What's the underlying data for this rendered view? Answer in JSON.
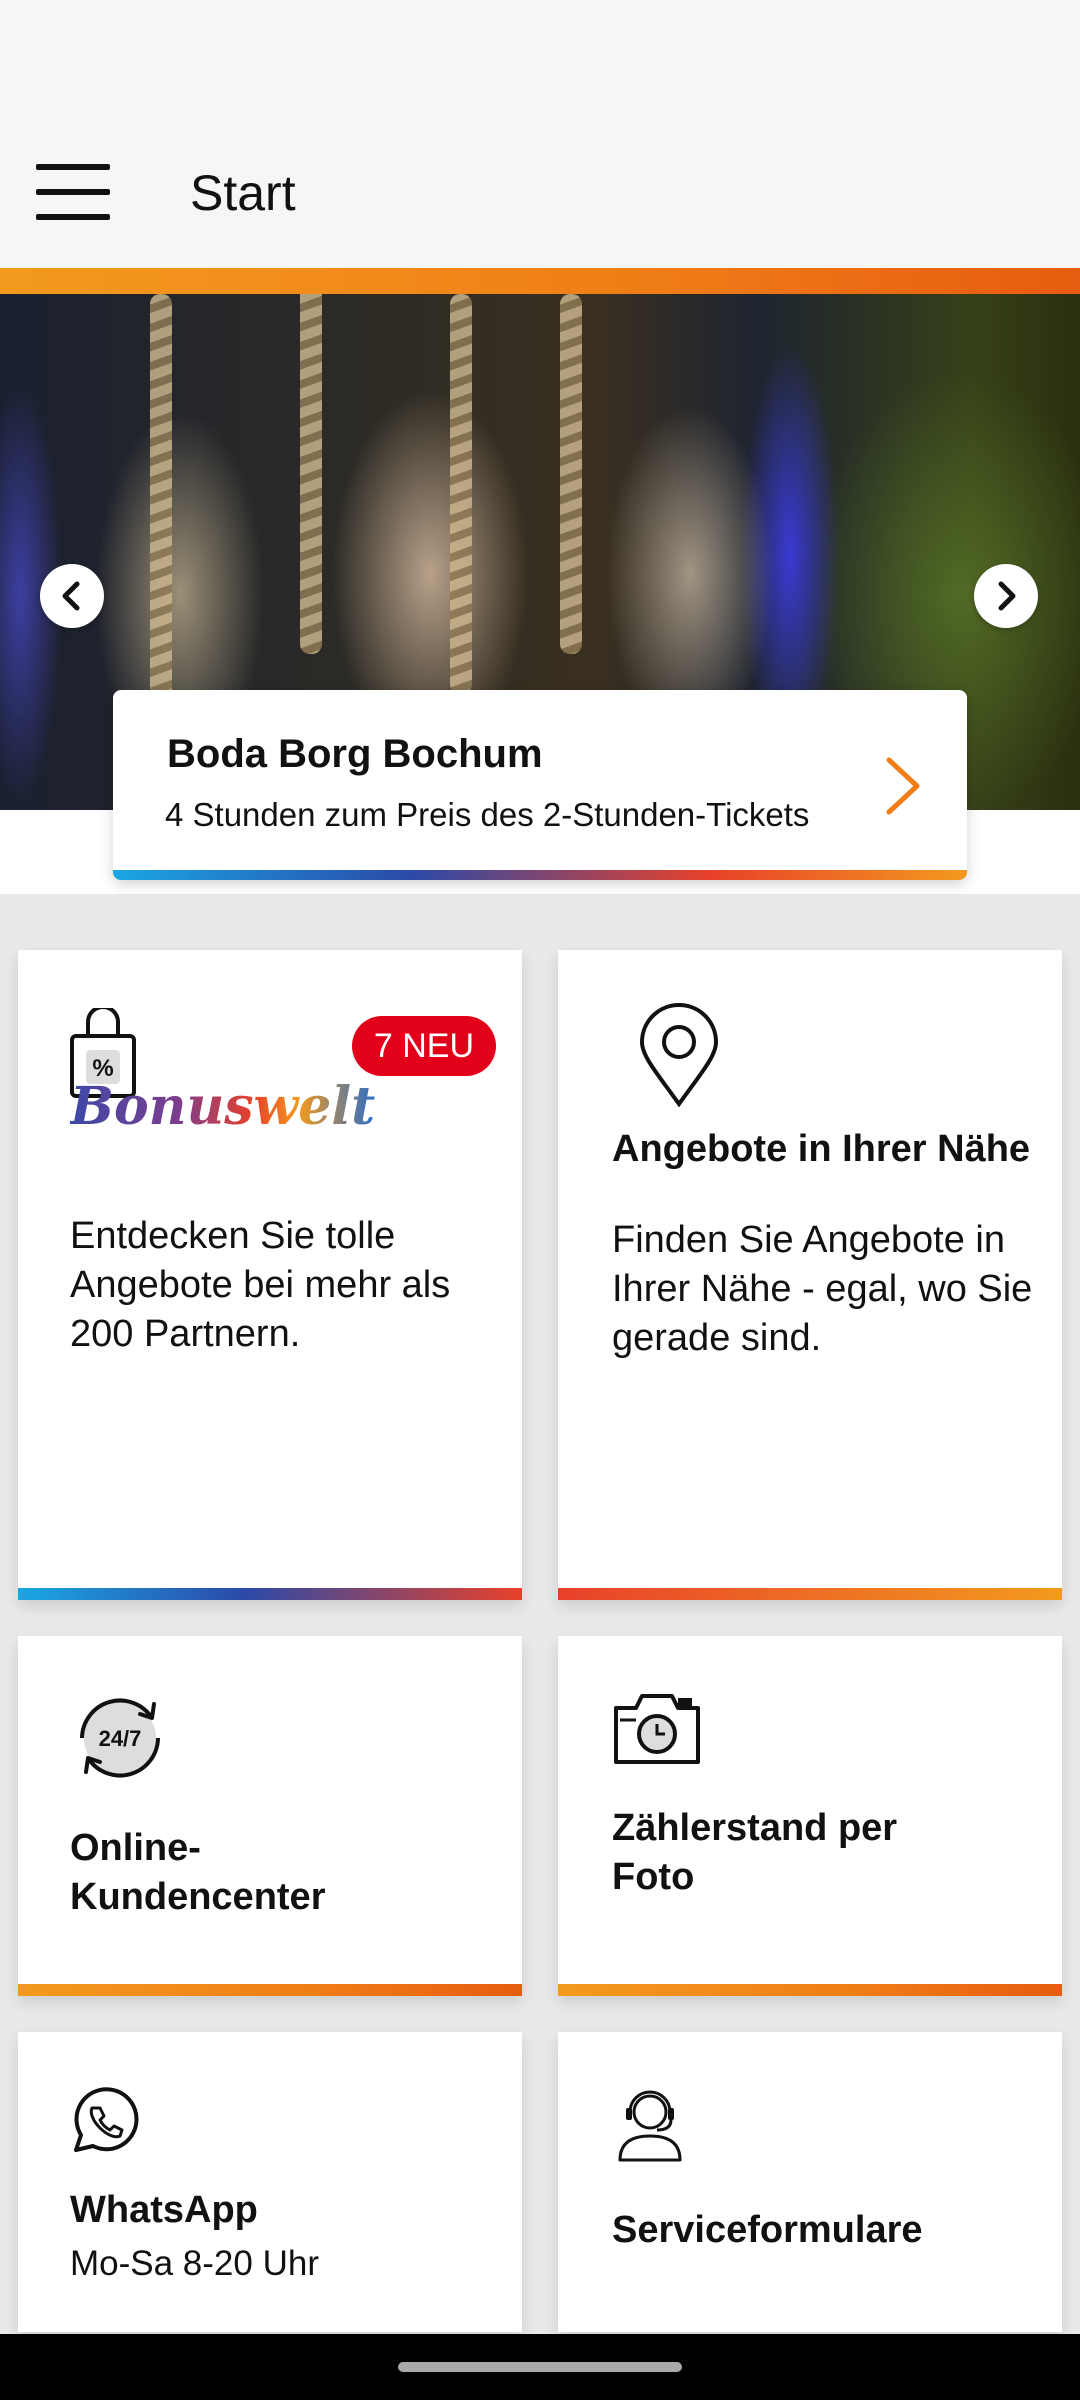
{
  "appbar": {
    "title": "Start"
  },
  "hero": {
    "promo": {
      "title": "Boda Borg Bochum",
      "subtitle": "4 Stunden zum Preis des 2-Stunden-Tickets"
    }
  },
  "tiles": {
    "bonus": {
      "badge": "7 NEU",
      "logo": "Bonuswelt",
      "text": "Entdecken Sie tolle Angebote bei mehr als 200 Partnern."
    },
    "nearby": {
      "heading": "Angebote in Ihrer Nähe",
      "text": "Finden Sie Angebote in Ihrer Nähe - egal, wo Sie gerade sind."
    },
    "online": {
      "icon_text": "24/7",
      "heading": "Online-Kundencenter"
    },
    "meter": {
      "heading": "Zählerstand per Foto"
    },
    "whatsapp": {
      "heading": "WhatsApp",
      "text": "Mo-Sa 8-20 Uhr"
    },
    "service": {
      "heading": "Serviceformulare"
    }
  },
  "icons": {
    "menu": "hamburger-icon",
    "hero_prev": "chevron-left-icon",
    "hero_next": "chevron-right-icon",
    "promo": "chevron-right-icon",
    "bonus": "shopping-bag-percent-icon",
    "nearby": "location-pin-icon",
    "online": "clock-24-7-icon",
    "meter": "camera-icon",
    "whatsapp": "whatsapp-icon",
    "service": "headset-person-icon"
  },
  "colors": {
    "accent_orange": "#f07d17",
    "badge_red": "#e2001a",
    "brand_blue": "#1aa6e4"
  }
}
